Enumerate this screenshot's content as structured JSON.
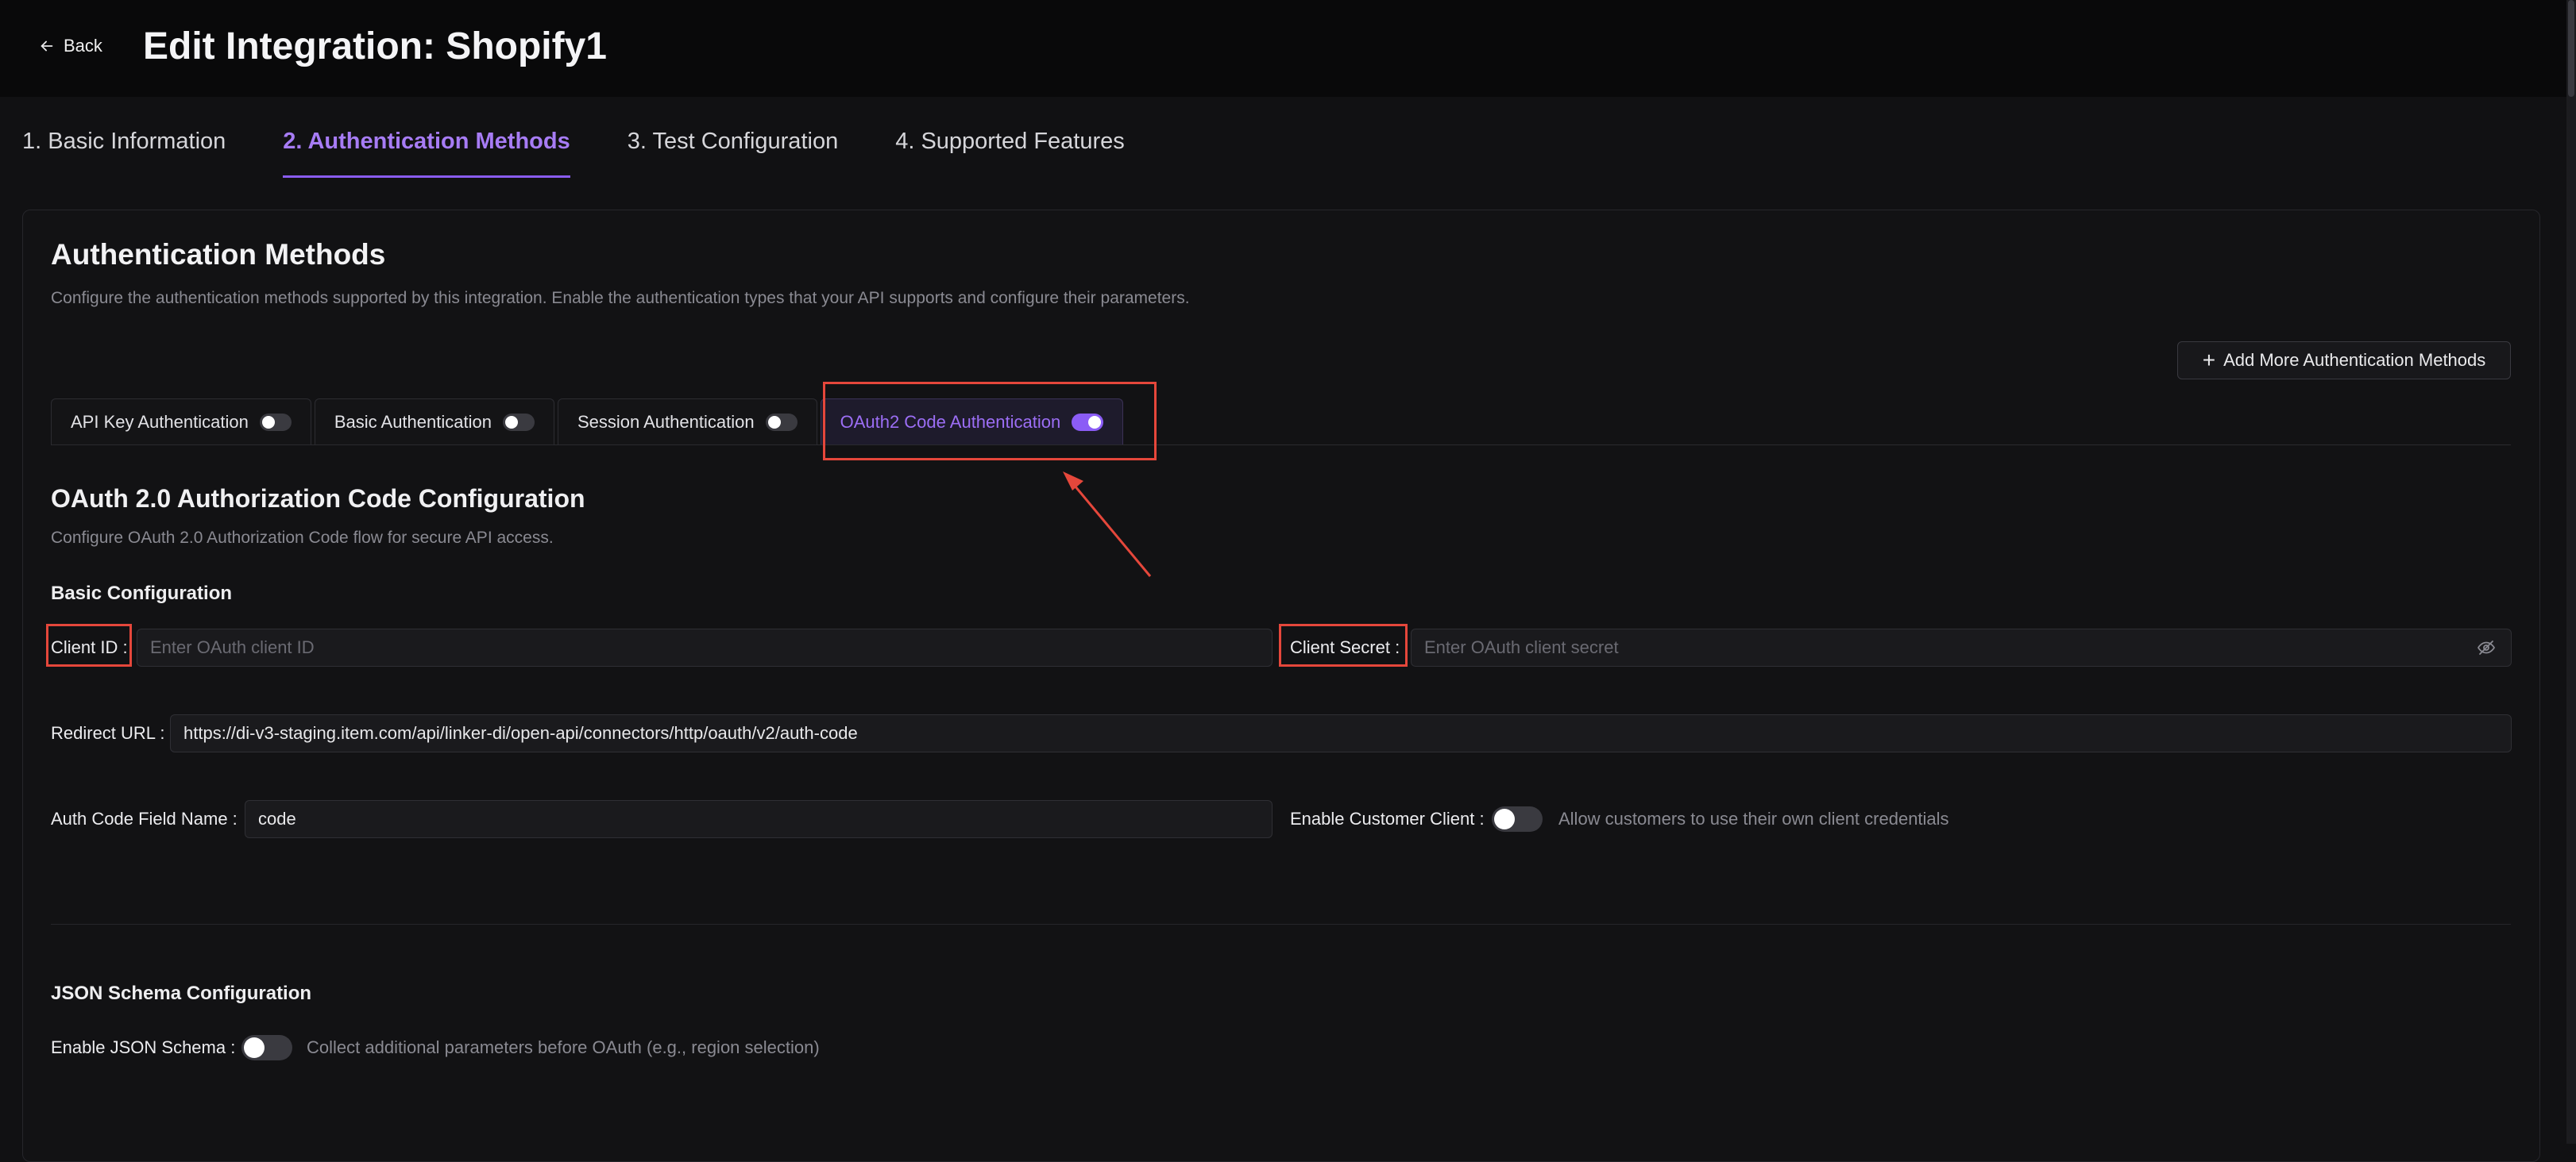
{
  "header": {
    "back_label": "Back",
    "title": "Edit Integration: Shopify1"
  },
  "steps": [
    {
      "label": "1. Basic Information",
      "active": false
    },
    {
      "label": "2. Authentication Methods",
      "active": true
    },
    {
      "label": "3. Test Configuration",
      "active": false
    },
    {
      "label": "4. Supported Features",
      "active": false
    }
  ],
  "auth_section": {
    "title": "Authentication Methods",
    "description": "Configure the authentication methods supported by this integration. Enable the authentication types that your API supports and configure their parameters.",
    "add_button_label": "Add More Authentication Methods"
  },
  "auth_tabs": [
    {
      "label": "API Key Authentication",
      "enabled": false,
      "active": false
    },
    {
      "label": "Basic Authentication",
      "enabled": false,
      "active": false
    },
    {
      "label": "Session Authentication",
      "enabled": false,
      "active": false
    },
    {
      "label": "OAuth2 Code Authentication",
      "enabled": true,
      "active": true
    }
  ],
  "oauth": {
    "title": "OAuth 2.0 Authorization Code Configuration",
    "description": "Configure OAuth 2.0 Authorization Code flow for secure API access.",
    "basic_config_label": "Basic Configuration",
    "client_id": {
      "label": "Client ID",
      "value": "",
      "placeholder": "Enter OAuth client ID"
    },
    "client_secret": {
      "label": "Client Secret",
      "value": "",
      "placeholder": "Enter OAuth client secret"
    },
    "redirect_url": {
      "label": "Redirect URL",
      "value": "https://di-v3-staging.item.com/api/linker-di/open-api/connectors/http/oauth/v2/auth-code"
    },
    "auth_code_field": {
      "label": "Auth Code Field Name",
      "value": "code"
    },
    "customer_client": {
      "label": "Enable Customer Client",
      "enabled": false,
      "hint": "Allow customers to use their own client credentials"
    }
  },
  "json_schema": {
    "title": "JSON Schema Configuration",
    "enable_label": "Enable JSON Schema",
    "enabled": false,
    "hint": "Collect additional parameters before OAuth (e.g., region selection)"
  },
  "colors": {
    "accent": "#8b5cf6",
    "annotation": "#e5473b",
    "background": "#111113"
  }
}
